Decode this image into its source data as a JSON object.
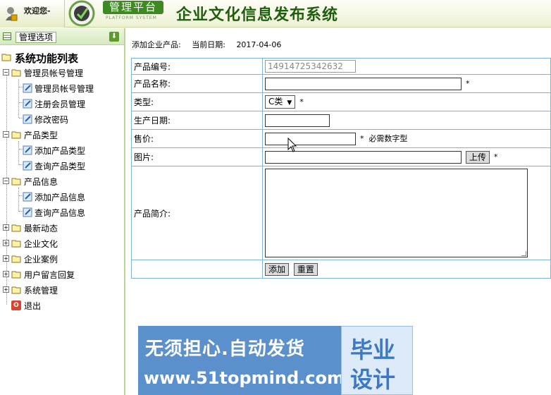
{
  "header": {
    "welcome": "欢迎您-",
    "platform_label": "管理平台",
    "platform_sub": "PLATFORM SYSTEM",
    "system_title": "企业文化信息发布系统"
  },
  "sidebar": {
    "header_label": "管理选项",
    "root_label": "系统功能列表",
    "groups": [
      {
        "label": "管理员帐号管理",
        "children": [
          "管理员帐号管理",
          "注册会员管理",
          "修改密码"
        ]
      },
      {
        "label": "产品类型",
        "children": [
          "添加产品类型",
          "查询产品类型"
        ]
      },
      {
        "label": "产品信息",
        "children": [
          "添加产品信息",
          "查询产品信息"
        ]
      },
      {
        "label": "最新动态"
      },
      {
        "label": "企业文化"
      },
      {
        "label": "企业案例"
      },
      {
        "label": "用户留言回复"
      },
      {
        "label": "系统管理"
      }
    ],
    "exit_label": "退出"
  },
  "main": {
    "crumb": "添加企业产品:",
    "date_label": "当前日期:",
    "date": "2017-04-06",
    "form": {
      "code_label": "产品编号:",
      "code_value": "14914725342632",
      "name_label": "产品名称:",
      "type_label": "类型:",
      "type_value": "C类",
      "date_label": "生产日期:",
      "price_label": "售价:",
      "price_hint": "必需数字型",
      "image_label": "图片:",
      "upload_button": "上传",
      "desc_label": "产品简介:",
      "required_mark": "*",
      "add_button": "添加",
      "reset_button": "重置"
    }
  },
  "watermark": {
    "line1": "无须担心.自动发货",
    "line2": "www.51topmind.com",
    "badge1": "毕业",
    "badge2": "设计"
  }
}
